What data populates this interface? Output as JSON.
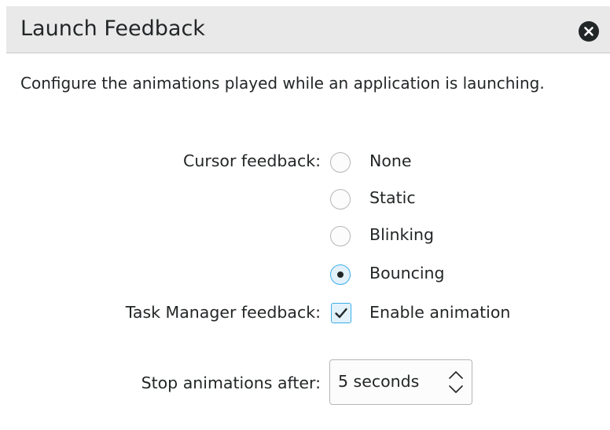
{
  "dialog": {
    "title": "Launch Feedback",
    "description": "Configure the animations played while an application is launching."
  },
  "cursor_feedback": {
    "label": "Cursor feedback:",
    "options": [
      {
        "label": "None",
        "selected": false
      },
      {
        "label": "Static",
        "selected": false
      },
      {
        "label": "Blinking",
        "selected": false
      },
      {
        "label": "Bouncing",
        "selected": true
      }
    ]
  },
  "task_manager_feedback": {
    "label": "Task Manager feedback:",
    "checkbox_label": "Enable animation",
    "checked": true
  },
  "stop_animations": {
    "label": "Stop animations after:",
    "value": "5 seconds"
  },
  "colors": {
    "accent": "#3daee9",
    "text": "#232627",
    "header_bg": "#e9e9ea"
  },
  "icons": {
    "close": "close-circle-icon",
    "check": "checkmark-icon",
    "spin_up": "chevron-up-icon",
    "spin_down": "chevron-down-icon"
  }
}
